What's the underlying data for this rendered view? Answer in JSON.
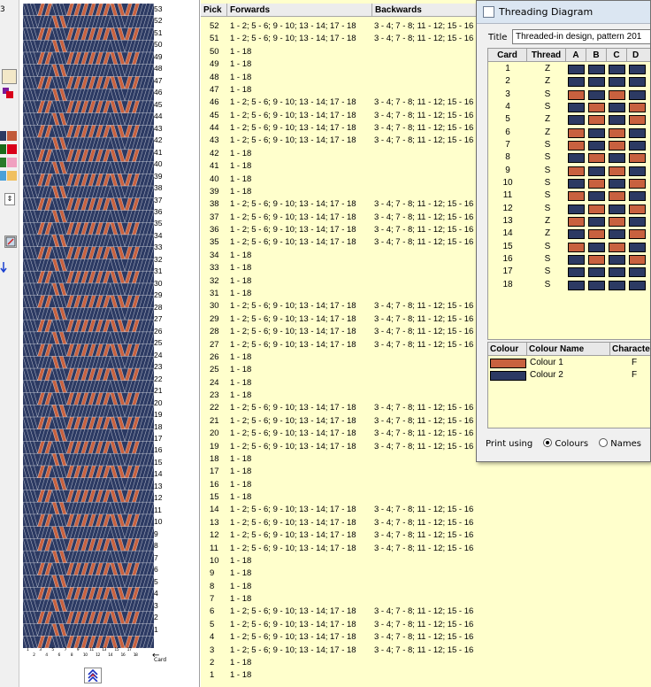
{
  "toolbar": {
    "num_label": "3",
    "palette": [
      "#f3e8c8",
      "#c25a3a",
      "#7b1a9a",
      "#1a6b1a",
      "#d9001a",
      "#2a7a2a",
      "#f0a0c0",
      "#4aa0d8",
      "#f0c060"
    ]
  },
  "pattern": {
    "colour_a": "#c8613f",
    "colour_b": "#2c3a63",
    "card_axis_label": "Card",
    "row_numbers": [
      "53",
      "52",
      "51",
      "50",
      "49",
      "48",
      "47",
      "46",
      "45",
      "44",
      "43",
      "42",
      "41",
      "40",
      "39",
      "38",
      "37",
      "36",
      "35",
      "34",
      "33",
      "32",
      "31",
      "30",
      "29",
      "28",
      "27",
      "26",
      "25",
      "24",
      "23",
      "22",
      "21",
      "20",
      "19",
      "18",
      "17",
      "16",
      "15",
      "14",
      "13",
      "12",
      "11",
      "10",
      "9",
      "8",
      "7",
      "6",
      "5",
      "4",
      "3",
      "2",
      "1"
    ]
  },
  "pick_table": {
    "headers": {
      "pick": "Pick",
      "forwards": "Forwards",
      "backwards": "Backwards"
    },
    "rows": [
      {
        "pick": "52",
        "fwd": "1 - 2; 5 - 6; 9 - 10; 13 - 14; 17 - 18",
        "bwd": "3 - 4; 7 - 8; 11 - 12; 15 - 16"
      },
      {
        "pick": "51",
        "fwd": "1 - 2; 5 - 6; 9 - 10; 13 - 14; 17 - 18",
        "bwd": "3 - 4; 7 - 8; 11 - 12; 15 - 16"
      },
      {
        "pick": "50",
        "fwd": "1 - 18",
        "bwd": ""
      },
      {
        "pick": "49",
        "fwd": "1 - 18",
        "bwd": ""
      },
      {
        "pick": "48",
        "fwd": "1 - 18",
        "bwd": ""
      },
      {
        "pick": "47",
        "fwd": "1 - 18",
        "bwd": ""
      },
      {
        "pick": "46",
        "fwd": "1 - 2; 5 - 6; 9 - 10; 13 - 14; 17 - 18",
        "bwd": "3 - 4; 7 - 8; 11 - 12; 15 - 16"
      },
      {
        "pick": "45",
        "fwd": "1 - 2; 5 - 6; 9 - 10; 13 - 14; 17 - 18",
        "bwd": "3 - 4; 7 - 8; 11 - 12; 15 - 16"
      },
      {
        "pick": "44",
        "fwd": "1 - 2; 5 - 6; 9 - 10; 13 - 14; 17 - 18",
        "bwd": "3 - 4; 7 - 8; 11 - 12; 15 - 16"
      },
      {
        "pick": "43",
        "fwd": "1 - 2; 5 - 6; 9 - 10; 13 - 14; 17 - 18",
        "bwd": "3 - 4; 7 - 8; 11 - 12; 15 - 16"
      },
      {
        "pick": "42",
        "fwd": "1 - 18",
        "bwd": ""
      },
      {
        "pick": "41",
        "fwd": "1 - 18",
        "bwd": ""
      },
      {
        "pick": "40",
        "fwd": "1 - 18",
        "bwd": ""
      },
      {
        "pick": "39",
        "fwd": "1 - 18",
        "bwd": ""
      },
      {
        "pick": "38",
        "fwd": "1 - 2; 5 - 6; 9 - 10; 13 - 14; 17 - 18",
        "bwd": "3 - 4; 7 - 8; 11 - 12; 15 - 16"
      },
      {
        "pick": "37",
        "fwd": "1 - 2; 5 - 6; 9 - 10; 13 - 14; 17 - 18",
        "bwd": "3 - 4; 7 - 8; 11 - 12; 15 - 16"
      },
      {
        "pick": "36",
        "fwd": "1 - 2; 5 - 6; 9 - 10; 13 - 14; 17 - 18",
        "bwd": "3 - 4; 7 - 8; 11 - 12; 15 - 16"
      },
      {
        "pick": "35",
        "fwd": "1 - 2; 5 - 6; 9 - 10; 13 - 14; 17 - 18",
        "bwd": "3 - 4; 7 - 8; 11 - 12; 15 - 16"
      },
      {
        "pick": "34",
        "fwd": "1 - 18",
        "bwd": ""
      },
      {
        "pick": "33",
        "fwd": "1 - 18",
        "bwd": ""
      },
      {
        "pick": "32",
        "fwd": "1 - 18",
        "bwd": ""
      },
      {
        "pick": "31",
        "fwd": "1 - 18",
        "bwd": ""
      },
      {
        "pick": "30",
        "fwd": "1 - 2; 5 - 6; 9 - 10; 13 - 14; 17 - 18",
        "bwd": "3 - 4; 7 - 8; 11 - 12; 15 - 16"
      },
      {
        "pick": "29",
        "fwd": "1 - 2; 5 - 6; 9 - 10; 13 - 14; 17 - 18",
        "bwd": "3 - 4; 7 - 8; 11 - 12; 15 - 16"
      },
      {
        "pick": "28",
        "fwd": "1 - 2; 5 - 6; 9 - 10; 13 - 14; 17 - 18",
        "bwd": "3 - 4; 7 - 8; 11 - 12; 15 - 16"
      },
      {
        "pick": "27",
        "fwd": "1 - 2; 5 - 6; 9 - 10; 13 - 14; 17 - 18",
        "bwd": "3 - 4; 7 - 8; 11 - 12; 15 - 16"
      },
      {
        "pick": "26",
        "fwd": "1 - 18",
        "bwd": ""
      },
      {
        "pick": "25",
        "fwd": "1 - 18",
        "bwd": ""
      },
      {
        "pick": "24",
        "fwd": "1 - 18",
        "bwd": ""
      },
      {
        "pick": "23",
        "fwd": "1 - 18",
        "bwd": ""
      },
      {
        "pick": "22",
        "fwd": "1 - 2; 5 - 6; 9 - 10; 13 - 14; 17 - 18",
        "bwd": "3 - 4; 7 - 8; 11 - 12; 15 - 16"
      },
      {
        "pick": "21",
        "fwd": "1 - 2; 5 - 6; 9 - 10; 13 - 14; 17 - 18",
        "bwd": "3 - 4; 7 - 8; 11 - 12; 15 - 16"
      },
      {
        "pick": "20",
        "fwd": "1 - 2; 5 - 6; 9 - 10; 13 - 14; 17 - 18",
        "bwd": "3 - 4; 7 - 8; 11 - 12; 15 - 16"
      },
      {
        "pick": "19",
        "fwd": "1 - 2; 5 - 6; 9 - 10; 13 - 14; 17 - 18",
        "bwd": "3 - 4; 7 - 8; 11 - 12; 15 - 16"
      },
      {
        "pick": "18",
        "fwd": "1 - 18",
        "bwd": ""
      },
      {
        "pick": "17",
        "fwd": "1 - 18",
        "bwd": ""
      },
      {
        "pick": "16",
        "fwd": "1 - 18",
        "bwd": ""
      },
      {
        "pick": "15",
        "fwd": "1 - 18",
        "bwd": ""
      },
      {
        "pick": "14",
        "fwd": "1 - 2; 5 - 6; 9 - 10; 13 - 14; 17 - 18",
        "bwd": "3 - 4; 7 - 8; 11 - 12; 15 - 16"
      },
      {
        "pick": "13",
        "fwd": "1 - 2; 5 - 6; 9 - 10; 13 - 14; 17 - 18",
        "bwd": "3 - 4; 7 - 8; 11 - 12; 15 - 16"
      },
      {
        "pick": "12",
        "fwd": "1 - 2; 5 - 6; 9 - 10; 13 - 14; 17 - 18",
        "bwd": "3 - 4; 7 - 8; 11 - 12; 15 - 16"
      },
      {
        "pick": "11",
        "fwd": "1 - 2; 5 - 6; 9 - 10; 13 - 14; 17 - 18",
        "bwd": "3 - 4; 7 - 8; 11 - 12; 15 - 16"
      },
      {
        "pick": "10",
        "fwd": "1 - 18",
        "bwd": ""
      },
      {
        "pick": "9",
        "fwd": "1 - 18",
        "bwd": ""
      },
      {
        "pick": "8",
        "fwd": "1 - 18",
        "bwd": ""
      },
      {
        "pick": "7",
        "fwd": "1 - 18",
        "bwd": ""
      },
      {
        "pick": "6",
        "fwd": "1 - 2; 5 - 6; 9 - 10; 13 - 14; 17 - 18",
        "bwd": "3 - 4; 7 - 8; 11 - 12; 15 - 16"
      },
      {
        "pick": "5",
        "fwd": "1 - 2; 5 - 6; 9 - 10; 13 - 14; 17 - 18",
        "bwd": "3 - 4; 7 - 8; 11 - 12; 15 - 16"
      },
      {
        "pick": "4",
        "fwd": "1 - 2; 5 - 6; 9 - 10; 13 - 14; 17 - 18",
        "bwd": "3 - 4; 7 - 8; 11 - 12; 15 - 16"
      },
      {
        "pick": "3",
        "fwd": "1 - 2; 5 - 6; 9 - 10; 13 - 14; 17 - 18",
        "bwd": "3 - 4; 7 - 8; 11 - 12; 15 - 16"
      },
      {
        "pick": "2",
        "fwd": "1 - 18",
        "bwd": ""
      },
      {
        "pick": "1",
        "fwd": "1 - 18",
        "bwd": ""
      }
    ]
  },
  "threading_dialog": {
    "window_title": "Threading Diagram",
    "title_label": "Title",
    "title_value": "Threaded-in design, pattern 201",
    "grid_headers": {
      "card": "Card",
      "thread": "Thread",
      "a": "A",
      "b": "B",
      "c": "C",
      "d": "D"
    },
    "colour_1_hex": "#c8613f",
    "colour_2_hex": "#2c3a63",
    "cards": [
      {
        "card": "1",
        "thread": "Z",
        "holes": [
          2,
          2,
          2,
          2
        ]
      },
      {
        "card": "2",
        "thread": "Z",
        "holes": [
          2,
          2,
          2,
          2
        ]
      },
      {
        "card": "3",
        "thread": "S",
        "holes": [
          1,
          2,
          1,
          2
        ]
      },
      {
        "card": "4",
        "thread": "S",
        "holes": [
          2,
          1,
          2,
          1
        ]
      },
      {
        "card": "5",
        "thread": "Z",
        "holes": [
          2,
          1,
          2,
          1
        ]
      },
      {
        "card": "6",
        "thread": "Z",
        "holes": [
          1,
          2,
          1,
          2
        ]
      },
      {
        "card": "7",
        "thread": "S",
        "holes": [
          1,
          2,
          1,
          2
        ]
      },
      {
        "card": "8",
        "thread": "S",
        "holes": [
          2,
          1,
          2,
          1
        ]
      },
      {
        "card": "9",
        "thread": "S",
        "holes": [
          1,
          2,
          1,
          2
        ]
      },
      {
        "card": "10",
        "thread": "S",
        "holes": [
          2,
          1,
          2,
          1
        ]
      },
      {
        "card": "11",
        "thread": "S",
        "holes": [
          1,
          2,
          1,
          2
        ]
      },
      {
        "card": "12",
        "thread": "S",
        "holes": [
          2,
          1,
          2,
          1
        ]
      },
      {
        "card": "13",
        "thread": "Z",
        "holes": [
          1,
          2,
          1,
          2
        ]
      },
      {
        "card": "14",
        "thread": "Z",
        "holes": [
          2,
          1,
          2,
          1
        ]
      },
      {
        "card": "15",
        "thread": "S",
        "holes": [
          1,
          2,
          1,
          2
        ]
      },
      {
        "card": "16",
        "thread": "S",
        "holes": [
          2,
          1,
          2,
          1
        ]
      },
      {
        "card": "17",
        "thread": "S",
        "holes": [
          2,
          2,
          2,
          2
        ]
      },
      {
        "card": "18",
        "thread": "S",
        "holes": [
          2,
          2,
          2,
          2
        ]
      }
    ],
    "colour_headers": {
      "colour": "Colour",
      "name": "Colour Name",
      "character": "Characte"
    },
    "colours": [
      {
        "name": "Colour 1",
        "char": "F",
        "hex": "#c8613f"
      },
      {
        "name": "Colour 2",
        "char": "F",
        "hex": "#2c3a63"
      }
    ],
    "print_using": {
      "label": "Print using",
      "opt_colours": "Colours",
      "opt_names": "Names"
    }
  }
}
